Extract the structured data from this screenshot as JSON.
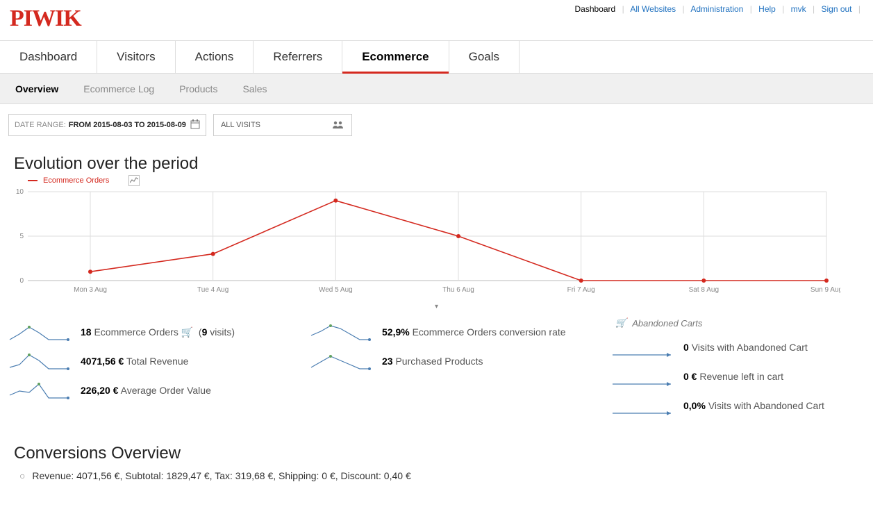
{
  "topmenu": {
    "dashboard": "Dashboard",
    "all_websites": "All Websites",
    "administration": "Administration",
    "help": "Help",
    "user": "mvk",
    "sign_out": "Sign out"
  },
  "logo": "PIWIK",
  "tabs": [
    "Dashboard",
    "Visitors",
    "Actions",
    "Referrers",
    "Ecommerce",
    "Goals"
  ],
  "active_tab": "Ecommerce",
  "subtabs": [
    "Overview",
    "Ecommerce Log",
    "Products",
    "Sales"
  ],
  "active_subtab": "Overview",
  "controls": {
    "date_range_label": "DATE RANGE:",
    "date_range_value": "FROM 2015-08-03 TO 2015-08-09",
    "segment": "ALL VISITS"
  },
  "chart_title": "Evolution over the period",
  "legend_label": "Ecommerce Orders",
  "chart_data": {
    "type": "line",
    "title": "Evolution over the period",
    "xlabel": "",
    "ylabel": "",
    "ylim": [
      0,
      10
    ],
    "yticks": [
      0,
      5,
      10
    ],
    "categories": [
      "Mon 3 Aug",
      "Tue 4 Aug",
      "Wed 5 Aug",
      "Thu 6 Aug",
      "Fri 7 Aug",
      "Sat 8 Aug",
      "Sun 9 Aug"
    ],
    "series": [
      {
        "name": "Ecommerce Orders",
        "color": "#d4291f",
        "values": [
          1,
          3,
          9,
          5,
          0,
          0,
          0
        ]
      }
    ]
  },
  "stats": {
    "orders_value": "18",
    "orders_label": "Ecommerce Orders",
    "orders_visits": "(9 visits)",
    "revenue_value": "4071,56 €",
    "revenue_label": "Total Revenue",
    "aov_value": "226,20 €",
    "aov_label": "Average Order Value",
    "conv_value": "52,9%",
    "conv_label": "Ecommerce Orders conversion rate",
    "purchased_value": "23",
    "purchased_label": "Purchased Products"
  },
  "abandoned": {
    "title": "Abandoned Carts",
    "visits_value": "0",
    "visits_label": "Visits with Abandoned Cart",
    "revenue_value": "0 €",
    "revenue_label": "Revenue left in cart",
    "pct_value": "0,0%",
    "pct_label": "Visits with Abandoned Cart"
  },
  "conversions": {
    "title": "Conversions Overview",
    "line": "Revenue: 4071,56 €, Subtotal: 1829,47 €, Tax: 319,68 €, Shipping: 0 €, Discount: 0,40 €"
  }
}
